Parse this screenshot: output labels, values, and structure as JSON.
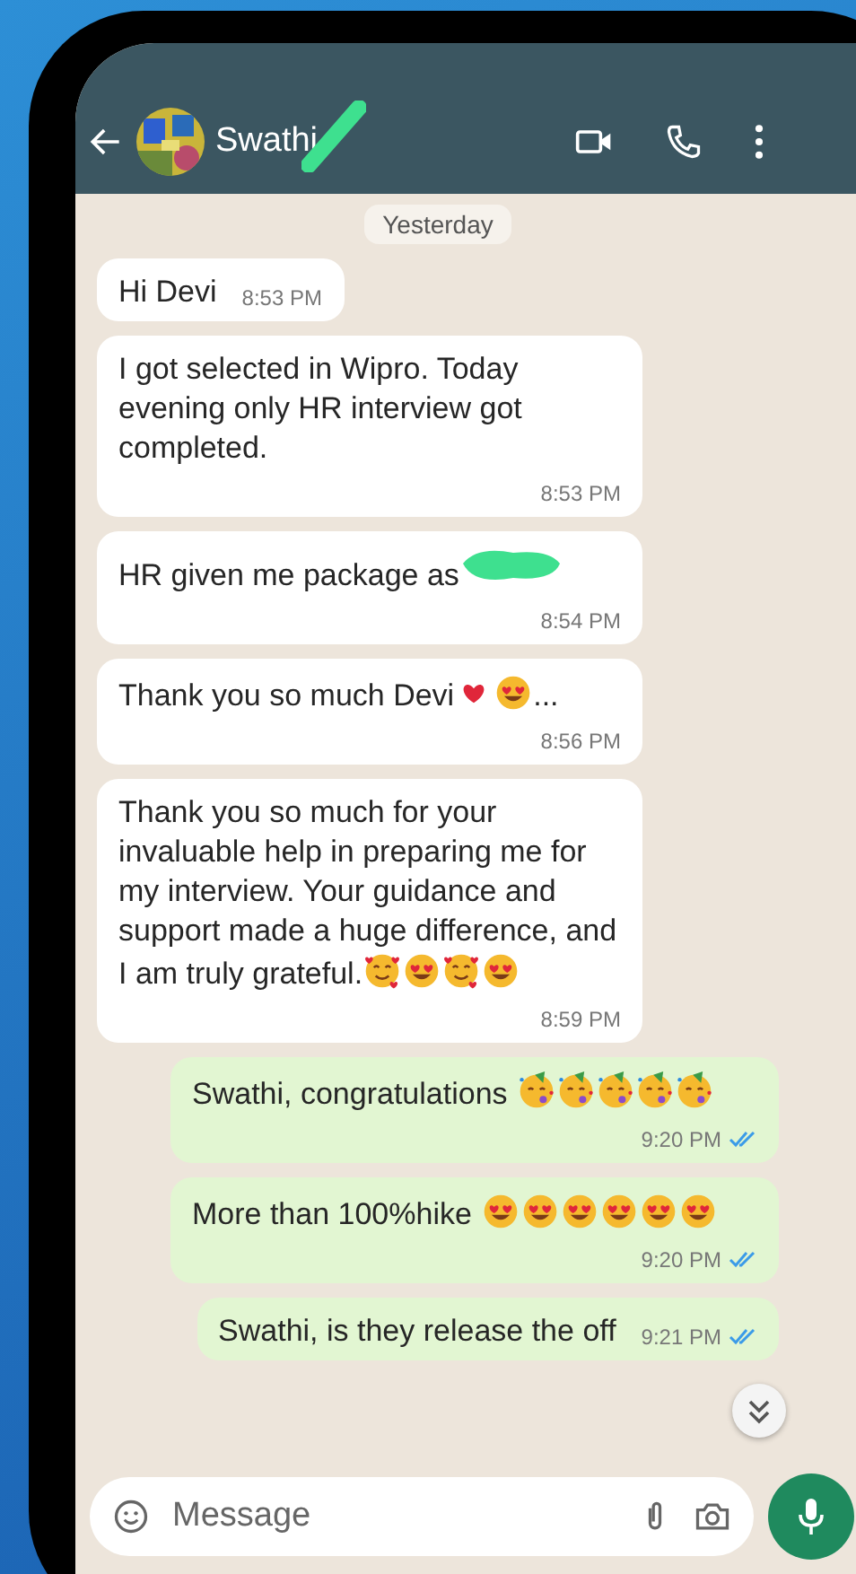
{
  "header": {
    "contact_name": "Swathi",
    "name_redacted": true
  },
  "date_chip": "Yesterday",
  "messages": [
    {
      "kind": "incoming",
      "segments": [
        {
          "kind": "text",
          "text": "Hi Devi"
        }
      ],
      "time": "8:53 PM",
      "redacted": false
    },
    {
      "kind": "incoming",
      "segments": [
        {
          "kind": "text",
          "text": "I got selected in Wipro. Today evening only HR interview got completed."
        }
      ],
      "time": "8:53 PM",
      "redacted": false
    },
    {
      "kind": "incoming",
      "segments": [
        {
          "kind": "text",
          "text": "HR given me package as"
        }
      ],
      "time": "8:54 PM",
      "redacted": true
    },
    {
      "kind": "incoming",
      "segments": [
        {
          "kind": "text",
          "text": "Thank you so much Devi"
        },
        {
          "kind": "heart"
        },
        {
          "kind": "heart_eyes"
        },
        {
          "kind": "text",
          "text": "..."
        }
      ],
      "time": "8:56 PM",
      "redacted": false
    },
    {
      "kind": "incoming",
      "segments": [
        {
          "kind": "text",
          "text": "Thank you so much for your invaluable help in preparing me for my interview. Your guidance and support made a huge difference, and I am truly grateful."
        },
        {
          "kind": "hearts_smile"
        },
        {
          "kind": "heart_eyes"
        },
        {
          "kind": "hearts_smile"
        },
        {
          "kind": "heart_eyes"
        }
      ],
      "time": "8:59 PM",
      "redacted": false
    },
    {
      "kind": "outgoing",
      "segments": [
        {
          "kind": "text",
          "text": "Swathi, congratulations "
        },
        {
          "kind": "party"
        },
        {
          "kind": "party"
        },
        {
          "kind": "party"
        },
        {
          "kind": "party"
        },
        {
          "kind": "party"
        }
      ],
      "time": "9:20 PM",
      "read": true,
      "redacted": false
    },
    {
      "kind": "outgoing",
      "segments": [
        {
          "kind": "text",
          "text": "More than 100%hike "
        },
        {
          "kind": "heart_eyes"
        },
        {
          "kind": "heart_eyes"
        },
        {
          "kind": "heart_eyes"
        },
        {
          "kind": "heart_eyes"
        },
        {
          "kind": "heart_eyes"
        },
        {
          "kind": "heart_eyes"
        }
      ],
      "time": "9:20 PM",
      "read": true,
      "redacted": false
    },
    {
      "kind": "outgoing",
      "segments": [
        {
          "kind": "text",
          "text": "Swathi, is they release the off"
        }
      ],
      "time": "9:21 PM",
      "read": true,
      "redacted": false
    }
  ],
  "composer": {
    "placeholder": "Message"
  }
}
